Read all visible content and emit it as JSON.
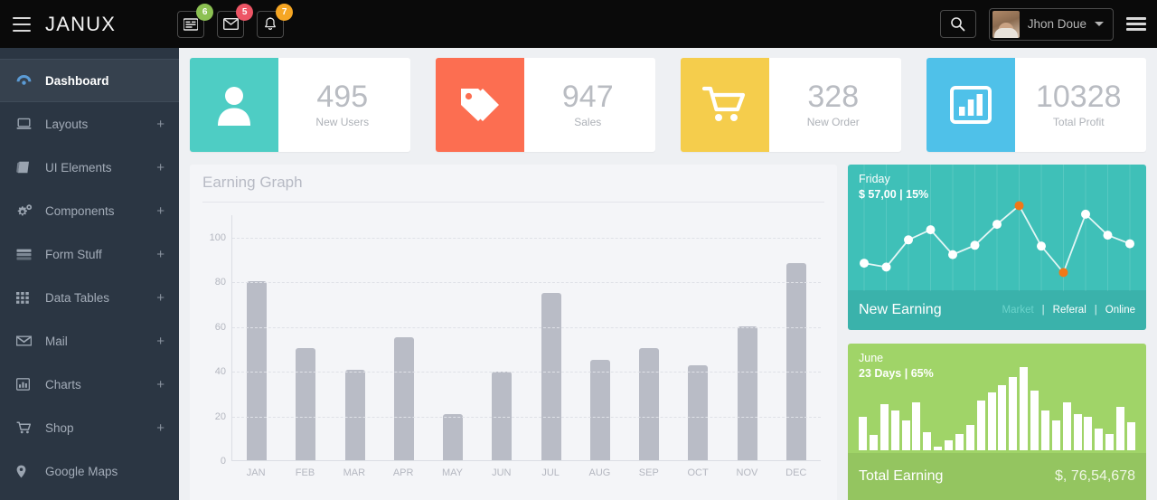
{
  "header": {
    "menu_icon": "hamburger-icon",
    "brand": "JANUX",
    "notifications": [
      {
        "icon": "tasks-icon",
        "badge": "6",
        "badge_color": "#8cc152"
      },
      {
        "icon": "envelope-icon",
        "badge": "5",
        "badge_color": "#ed5565"
      },
      {
        "icon": "bell-icon",
        "badge": "7",
        "badge_color": "#f6a623"
      }
    ],
    "search_icon": "search-icon",
    "user_name": "Jhon Doue",
    "caret_icon": "chevron-down-icon",
    "right_menu_icon": "hamburger-icon"
  },
  "sidebar": {
    "items": [
      {
        "label": "Dashboard",
        "icon": "dashboard-icon",
        "expand": "",
        "active": true
      },
      {
        "label": "Layouts",
        "icon": "laptop-icon",
        "expand": "+",
        "active": false
      },
      {
        "label": "UI Elements",
        "icon": "book-icon",
        "expand": "+",
        "active": false
      },
      {
        "label": "Components",
        "icon": "gears-icon",
        "expand": "+",
        "active": false
      },
      {
        "label": "Form Stuff",
        "icon": "form-icon",
        "expand": "+",
        "active": false
      },
      {
        "label": "Data Tables",
        "icon": "grid-icon",
        "expand": "+",
        "active": false
      },
      {
        "label": "Mail",
        "icon": "envelope-icon",
        "expand": "+",
        "active": false
      },
      {
        "label": "Charts",
        "icon": "bar-chart-icon",
        "expand": "+",
        "active": false
      },
      {
        "label": "Shop",
        "icon": "cart-icon",
        "expand": "+",
        "active": false
      },
      {
        "label": "Google Maps",
        "icon": "map-pin-icon",
        "expand": "",
        "active": false
      }
    ]
  },
  "stats": [
    {
      "value": "495",
      "label": "New Users",
      "icon": "user-icon",
      "color": "#4ecdc4"
    },
    {
      "value": "947",
      "label": "Sales",
      "icon": "tags-icon",
      "color": "#fc6e51"
    },
    {
      "value": "328",
      "label": "New Order",
      "icon": "cart-icon",
      "color": "#f5cd4c"
    },
    {
      "value": "10328",
      "label": "Total Profit",
      "icon": "bar-chart-icon",
      "color": "#4fc1e9"
    }
  ],
  "chart_data": [
    {
      "type": "bar",
      "title": "Earning Graph",
      "categories": [
        "JAN",
        "FEB",
        "MAR",
        "APR",
        "MAY",
        "JUN",
        "JUL",
        "AUG",
        "SEP",
        "OCT",
        "NOV",
        "DEC"
      ],
      "values": [
        80,
        50,
        40.5,
        55,
        20.5,
        39.5,
        75,
        45,
        50,
        42.5,
        60,
        88
      ],
      "xlabel": "",
      "ylabel": "",
      "ylim": [
        0,
        110
      ],
      "yticks": [
        0,
        20,
        40,
        60,
        80,
        100
      ],
      "grid": true,
      "bar_color": "#b9bcc6",
      "legend": "none"
    },
    {
      "type": "line",
      "title": "New Earning",
      "subtitle_day": "Friday",
      "subtitle_amount": "$ 57,00 | 15%",
      "values": [
        22,
        17,
        52,
        65,
        33,
        45,
        72,
        96,
        44,
        10,
        85,
        58,
        47
      ],
      "highlight_indices": [
        7,
        9
      ],
      "highlight_color": "#f07818",
      "point_color": "#ffffff",
      "background": "#3fc0b8",
      "legend": [
        "Market",
        "Referal",
        "Online"
      ],
      "legend_active": "Market",
      "legend_position": "bottom-right"
    },
    {
      "type": "bar",
      "title": "Total Earning",
      "subtitle_month": "June",
      "subtitle_days": "23 Days | 65%",
      "values": [
        40,
        18,
        55,
        48,
        36,
        58,
        22,
        4,
        12,
        20,
        30,
        60,
        70,
        78,
        88,
        100,
        72,
        48,
        36,
        58,
        44,
        40,
        26,
        20,
        52,
        34
      ],
      "background": "#a0d468",
      "bar_color": "#ffffff",
      "footer_value": "$, 76,54,678"
    }
  ],
  "panels": {
    "earning_graph_title": "Earning Graph",
    "new_earning": {
      "day": "Friday",
      "amount": "$ 57,00 | 15%",
      "footer_title": "New Earning",
      "legend": [
        "Market",
        "Referal",
        "Online"
      ]
    },
    "total_earning": {
      "month": "June",
      "days": "23 Days | 65%",
      "footer_title": "Total Earning",
      "footer_value": "$, 76,54,678"
    }
  }
}
